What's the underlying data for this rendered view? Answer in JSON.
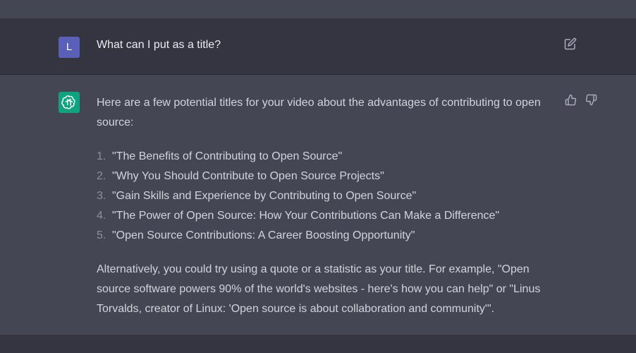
{
  "user_message": {
    "avatar_letter": "L",
    "text": "What can I put as a title?"
  },
  "assistant_message": {
    "intro": "Here are a few potential titles for your video about the advantages of contributing to open source:",
    "titles": [
      {
        "num": "1.",
        "text": "\"The Benefits of Contributing to Open Source\""
      },
      {
        "num": "2.",
        "text": "\"Why You Should Contribute to Open Source Projects\""
      },
      {
        "num": "3.",
        "text": "\"Gain Skills and Experience by Contributing to Open Source\""
      },
      {
        "num": "4.",
        "text": "\"The Power of Open Source: How Your Contributions Can Make a Difference\""
      },
      {
        "num": "5.",
        "text": "\"Open Source Contributions: A Career Boosting Opportunity\""
      }
    ],
    "closing": "Alternatively, you could try using a quote or a statistic as your title. For example, \"Open source software powers 90% of the world's websites - here's how you can help\" or \"Linus Torvalds, creator of Linux: 'Open source is about collaboration and community'\"."
  },
  "icons": {
    "edit": "edit-icon",
    "thumbs_up": "thumbs-up-icon",
    "thumbs_down": "thumbs-down-icon",
    "assistant_logo": "openai-logo-icon"
  },
  "colors": {
    "background_dark": "#343541",
    "background_light": "#444654",
    "user_avatar": "#5a5fb7",
    "assistant_avatar": "#10a37f"
  }
}
